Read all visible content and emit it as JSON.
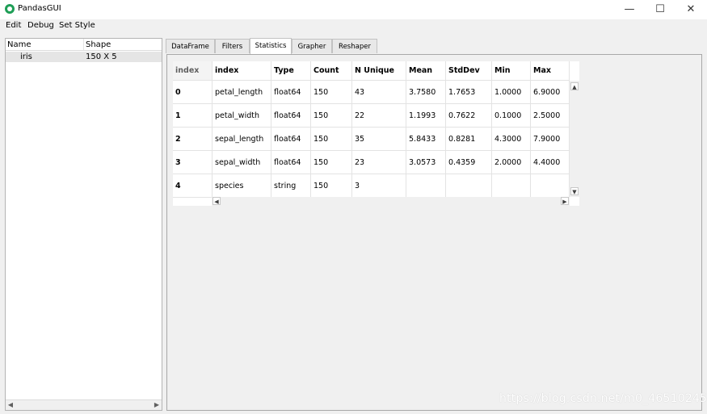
{
  "window": {
    "title": "PandasGUI",
    "controls": {
      "minimize": "—",
      "maximize": "☐",
      "close": "✕"
    }
  },
  "menu": [
    "Edit",
    "Debug",
    "Set Style"
  ],
  "navigator": {
    "headers": {
      "name": "Name",
      "shape": "Shape"
    },
    "items": [
      {
        "name": "iris",
        "shape": "150 X 5"
      }
    ]
  },
  "tabs": [
    {
      "label": "DataFrame",
      "active": false
    },
    {
      "label": "Filters",
      "active": false
    },
    {
      "label": "Statistics",
      "active": true
    },
    {
      "label": "Grapher",
      "active": false
    },
    {
      "label": "Reshaper",
      "active": false
    }
  ],
  "stats_table": {
    "index_header": "index",
    "columns": [
      "index",
      "Type",
      "Count",
      "N Unique",
      "Mean",
      "StdDev",
      "Min",
      "Max"
    ],
    "rows": [
      {
        "row_index": "0",
        "cells": [
          "petal_length",
          "float64",
          "150",
          "43",
          "3.7580",
          "1.7653",
          "1.0000",
          "6.9000"
        ]
      },
      {
        "row_index": "1",
        "cells": [
          "petal_width",
          "float64",
          "150",
          "22",
          "1.1993",
          "0.7622",
          "0.1000",
          "2.5000"
        ]
      },
      {
        "row_index": "2",
        "cells": [
          "sepal_length",
          "float64",
          "150",
          "35",
          "5.8433",
          "0.8281",
          "4.3000",
          "7.9000"
        ]
      },
      {
        "row_index": "3",
        "cells": [
          "sepal_width",
          "float64",
          "150",
          "23",
          "3.0573",
          "0.4359",
          "2.0000",
          "4.4000"
        ]
      },
      {
        "row_index": "4",
        "cells": [
          "species",
          "string",
          "150",
          "3",
          "",
          "",
          "",
          ""
        ]
      }
    ]
  },
  "watermark": "https://blog.csdn.net/m0_46510245",
  "colors": {
    "logo": "#1e9e56",
    "background": "#f0f0f0",
    "selected_row": "#e5e5e5"
  }
}
